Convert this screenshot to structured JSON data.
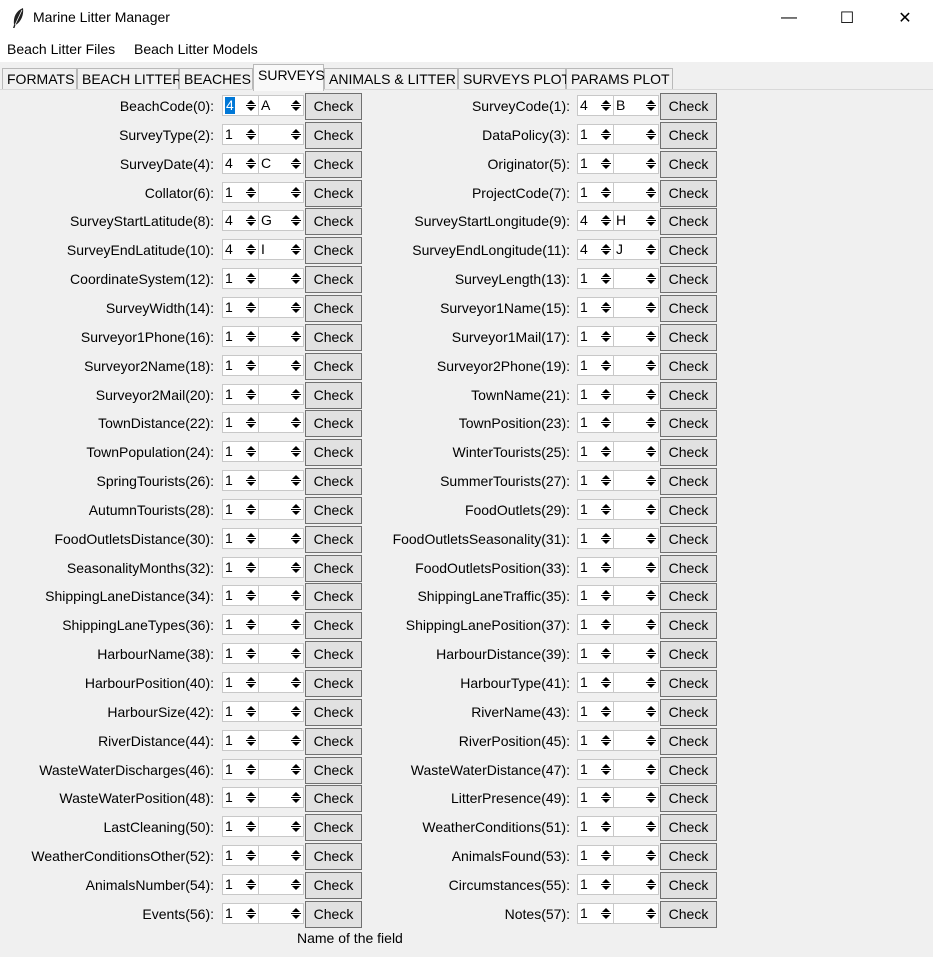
{
  "window": {
    "title": "Marine Litter Manager",
    "minimize_glyph": "—",
    "maximize_glyph": "☐",
    "close_glyph": "✕"
  },
  "menu": [
    "Beach Litter Files",
    "Beach Litter Models"
  ],
  "tabs": [
    "FORMATS",
    "BEACH LITTER",
    "BEACHES",
    "SURVEYS",
    "ANIMALS & LITTER",
    "SURVEYS PLOT",
    "PARAMS PLOT"
  ],
  "active_tab": "SURVEYS",
  "check_label": "Check",
  "footer": "Name of the field",
  "fields": [
    {
      "label": "BeachCode(0):",
      "num": "4",
      "text": "A"
    },
    {
      "label": "SurveyCode(1):",
      "num": "4",
      "text": "B"
    },
    {
      "label": "SurveyType(2):",
      "num": "1",
      "text": ""
    },
    {
      "label": "DataPolicy(3):",
      "num": "1",
      "text": ""
    },
    {
      "label": "SurveyDate(4):",
      "num": "4",
      "text": "C"
    },
    {
      "label": "Originator(5):",
      "num": "1",
      "text": ""
    },
    {
      "label": "Collator(6):",
      "num": "1",
      "text": ""
    },
    {
      "label": "ProjectCode(7):",
      "num": "1",
      "text": ""
    },
    {
      "label": "SurveyStartLatitude(8):",
      "num": "4",
      "text": "G"
    },
    {
      "label": "SurveyStartLongitude(9):",
      "num": "4",
      "text": "H"
    },
    {
      "label": "SurveyEndLatitude(10):",
      "num": "4",
      "text": "I"
    },
    {
      "label": "SurveyEndLongitude(11):",
      "num": "4",
      "text": "J"
    },
    {
      "label": "CoordinateSystem(12):",
      "num": "1",
      "text": ""
    },
    {
      "label": "SurveyLength(13):",
      "num": "1",
      "text": ""
    },
    {
      "label": "SurveyWidth(14):",
      "num": "1",
      "text": ""
    },
    {
      "label": "Surveyor1Name(15):",
      "num": "1",
      "text": ""
    },
    {
      "label": "Surveyor1Phone(16):",
      "num": "1",
      "text": ""
    },
    {
      "label": "Surveyor1Mail(17):",
      "num": "1",
      "text": ""
    },
    {
      "label": "Surveyor2Name(18):",
      "num": "1",
      "text": ""
    },
    {
      "label": "Surveyor2Phone(19):",
      "num": "1",
      "text": ""
    },
    {
      "label": "Surveyor2Mail(20):",
      "num": "1",
      "text": ""
    },
    {
      "label": "TownName(21):",
      "num": "1",
      "text": ""
    },
    {
      "label": "TownDistance(22):",
      "num": "1",
      "text": ""
    },
    {
      "label": "TownPosition(23):",
      "num": "1",
      "text": ""
    },
    {
      "label": "TownPopulation(24):",
      "num": "1",
      "text": ""
    },
    {
      "label": "WinterTourists(25):",
      "num": "1",
      "text": ""
    },
    {
      "label": "SpringTourists(26):",
      "num": "1",
      "text": ""
    },
    {
      "label": "SummerTourists(27):",
      "num": "1",
      "text": ""
    },
    {
      "label": "AutumnTourists(28):",
      "num": "1",
      "text": ""
    },
    {
      "label": "FoodOutlets(29):",
      "num": "1",
      "text": ""
    },
    {
      "label": "FoodOutletsDistance(30):",
      "num": "1",
      "text": ""
    },
    {
      "label": "FoodOutletsSeasonality(31):",
      "num": "1",
      "text": ""
    },
    {
      "label": "SeasonalityMonths(32):",
      "num": "1",
      "text": ""
    },
    {
      "label": "FoodOutletsPosition(33):",
      "num": "1",
      "text": ""
    },
    {
      "label": "ShippingLaneDistance(34):",
      "num": "1",
      "text": ""
    },
    {
      "label": "ShippingLaneTraffic(35):",
      "num": "1",
      "text": ""
    },
    {
      "label": "ShippingLaneTypes(36):",
      "num": "1",
      "text": ""
    },
    {
      "label": "ShippingLanePosition(37):",
      "num": "1",
      "text": ""
    },
    {
      "label": "HarbourName(38):",
      "num": "1",
      "text": ""
    },
    {
      "label": "HarbourDistance(39):",
      "num": "1",
      "text": ""
    },
    {
      "label": "HarbourPosition(40):",
      "num": "1",
      "text": ""
    },
    {
      "label": "HarbourType(41):",
      "num": "1",
      "text": ""
    },
    {
      "label": "HarbourSize(42):",
      "num": "1",
      "text": ""
    },
    {
      "label": "RiverName(43):",
      "num": "1",
      "text": ""
    },
    {
      "label": "RiverDistance(44):",
      "num": "1",
      "text": ""
    },
    {
      "label": "RiverPosition(45):",
      "num": "1",
      "text": ""
    },
    {
      "label": "WasteWaterDischarges(46):",
      "num": "1",
      "text": ""
    },
    {
      "label": "WasteWaterDistance(47):",
      "num": "1",
      "text": ""
    },
    {
      "label": "WasteWaterPosition(48):",
      "num": "1",
      "text": ""
    },
    {
      "label": "LitterPresence(49):",
      "num": "1",
      "text": ""
    },
    {
      "label": "LastCleaning(50):",
      "num": "1",
      "text": ""
    },
    {
      "label": "WeatherConditions(51):",
      "num": "1",
      "text": ""
    },
    {
      "label": "WeatherConditionsOther(52):",
      "num": "1",
      "text": ""
    },
    {
      "label": "AnimalsFound(53):",
      "num": "1",
      "text": ""
    },
    {
      "label": "AnimalsNumber(54):",
      "num": "1",
      "text": ""
    },
    {
      "label": "Circumstances(55):",
      "num": "1",
      "text": ""
    },
    {
      "label": "Events(56):",
      "num": "1",
      "text": ""
    },
    {
      "label": "Notes(57):",
      "num": "1",
      "text": ""
    }
  ]
}
